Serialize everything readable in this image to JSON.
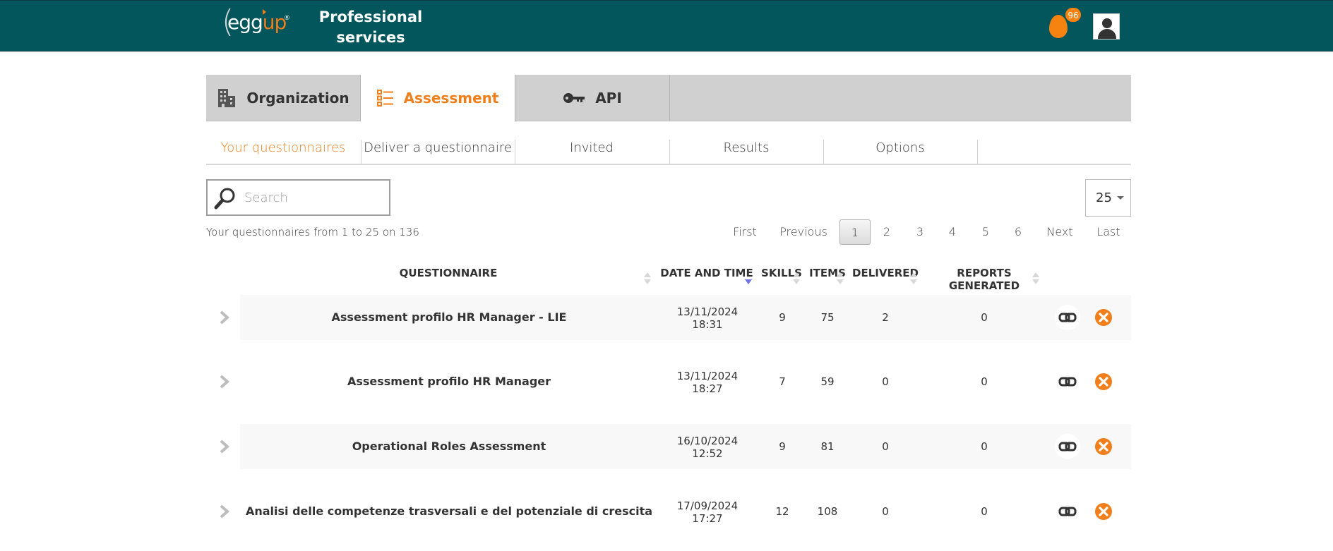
{
  "header": {
    "logo_text_egg": "egg",
    "logo_text_up": "up",
    "logo_reg": "®",
    "app_title": "Professional services",
    "notification_count": "96"
  },
  "main_tabs": [
    {
      "label": "Organization",
      "icon": "building-icon"
    },
    {
      "label": "Assessment",
      "icon": "list-icon",
      "active": true
    },
    {
      "label": "API",
      "icon": "key-icon"
    }
  ],
  "sub_tabs": [
    {
      "label": "Your questionnaires",
      "active": true
    },
    {
      "label": "Deliver a questionnaire"
    },
    {
      "label": "Invited"
    },
    {
      "label": "Results"
    },
    {
      "label": "Options"
    }
  ],
  "search": {
    "placeholder": "Search",
    "value": ""
  },
  "page_size": "25",
  "count_text": "Your questionnaires from 1 to 25 on 136",
  "pagination": {
    "first": "First",
    "previous": "Previous",
    "pages": [
      "1",
      "2",
      "3",
      "4",
      "5",
      "6"
    ],
    "current": "1",
    "next": "Next",
    "last": "Last"
  },
  "table": {
    "headers": {
      "questionnaire": "QUESTIONNAIRE",
      "date_time": "DATE AND TIME",
      "skills": "SKILLS",
      "items": "ITEMS",
      "delivered": "DELIVERED",
      "reports_line1": "REPORTS",
      "reports_line2": "GENERATED"
    },
    "rows": [
      {
        "name": "Assessment profilo HR Manager - LIE",
        "date": "13/11/2024",
        "time": "18:31",
        "skills": "9",
        "items": "75",
        "delivered": "2",
        "reports": "0"
      },
      {
        "name": "Assessment profilo HR Manager",
        "date": "13/11/2024",
        "time": "18:27",
        "skills": "7",
        "items": "59",
        "delivered": "0",
        "reports": "0"
      },
      {
        "name": "Operational Roles Assessment",
        "date": "16/10/2024",
        "time": "12:52",
        "skills": "9",
        "items": "81",
        "delivered": "0",
        "reports": "0"
      },
      {
        "name": "Analisi delle competenze trasversali e del potenziale di crescita",
        "date": "17/09/2024",
        "time": "17:27",
        "skills": "12",
        "items": "108",
        "delivered": "0",
        "reports": "0"
      }
    ]
  },
  "colors": {
    "header_bg": "#02565c",
    "accent": "#f07e1a",
    "tab_bg": "#d0d0d0",
    "sort_active": "#6f73e6"
  }
}
